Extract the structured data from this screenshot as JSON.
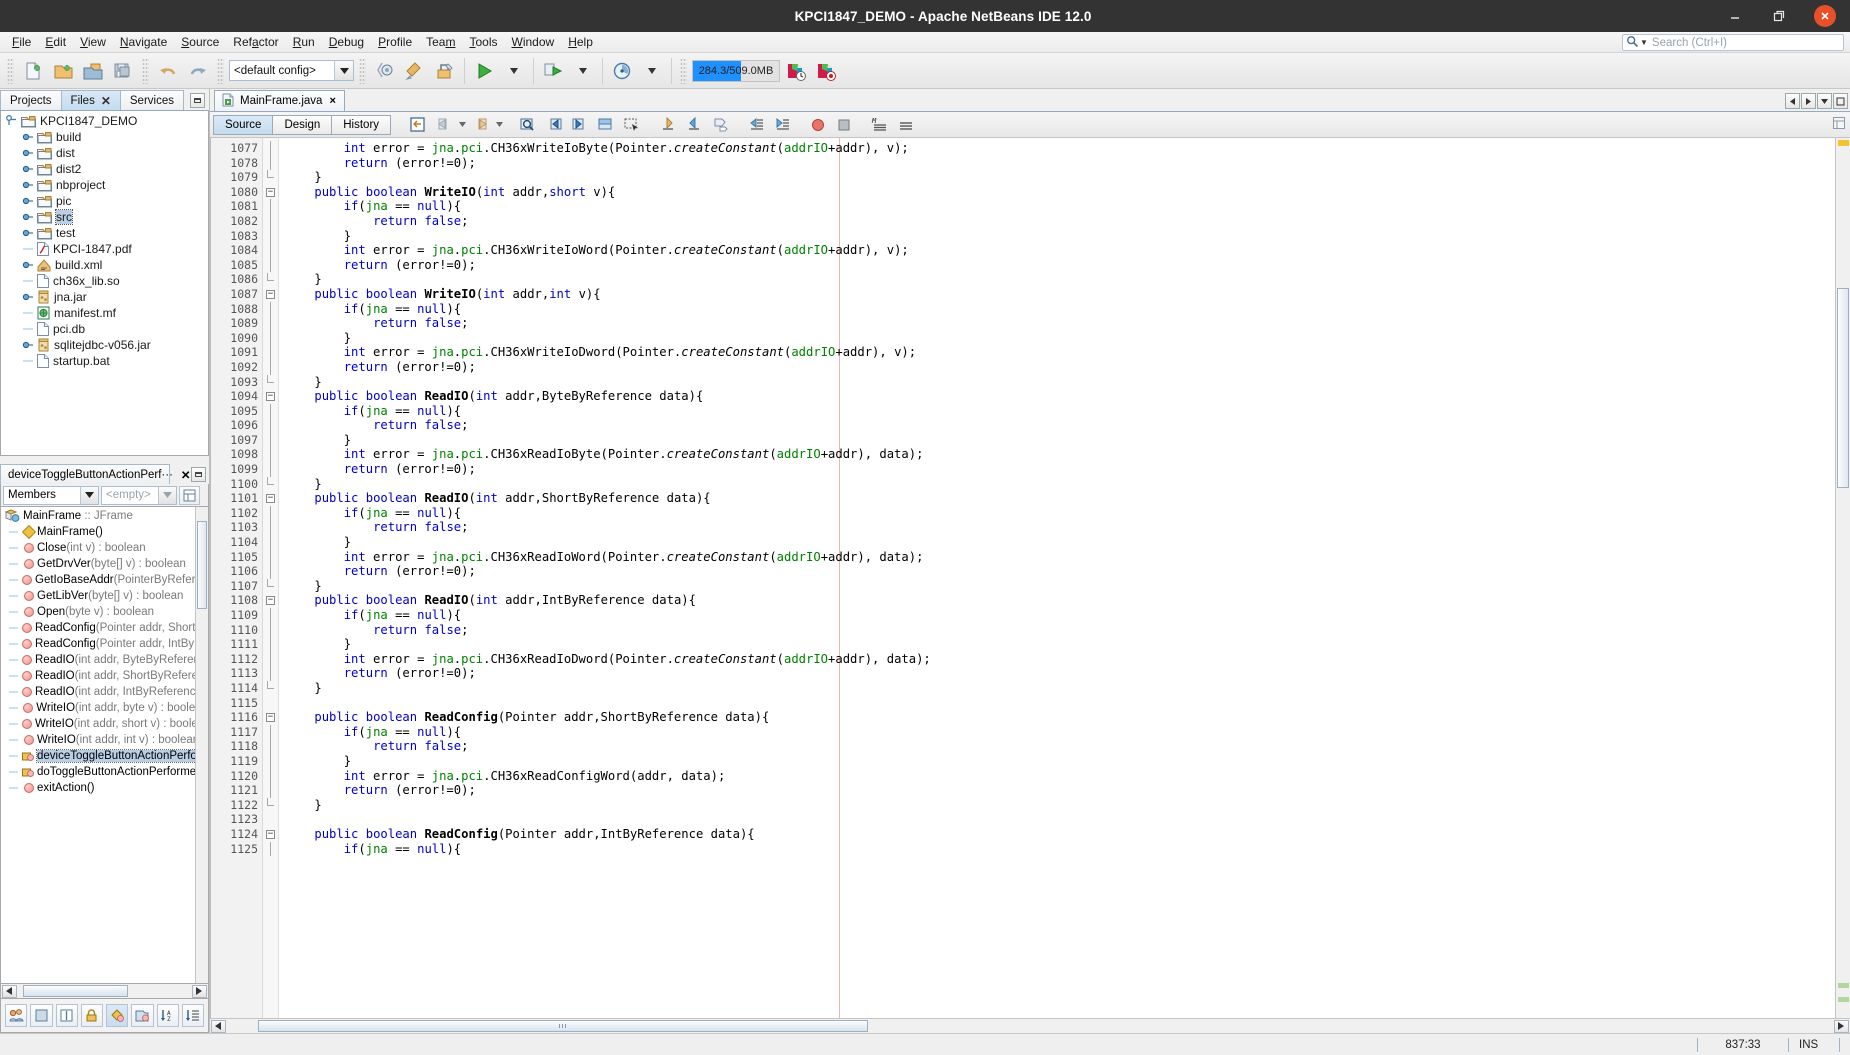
{
  "window": {
    "title": "KPCI1847_DEMO - Apache NetBeans IDE 12.0",
    "minimize_label": "Minimize",
    "restore_label": "Restore",
    "close_label": "Close"
  },
  "menubar": {
    "items": [
      {
        "label": "File",
        "mnemonic": "F"
      },
      {
        "label": "Edit",
        "mnemonic": "E"
      },
      {
        "label": "View",
        "mnemonic": "V"
      },
      {
        "label": "Navigate",
        "mnemonic": "N"
      },
      {
        "label": "Source",
        "mnemonic": "S"
      },
      {
        "label": "Refactor",
        "mnemonic": "a"
      },
      {
        "label": "Run",
        "mnemonic": "R"
      },
      {
        "label": "Debug",
        "mnemonic": "D"
      },
      {
        "label": "Profile",
        "mnemonic": "P"
      },
      {
        "label": "Team",
        "mnemonic": "m"
      },
      {
        "label": "Tools",
        "mnemonic": "T"
      },
      {
        "label": "Window",
        "mnemonic": "W"
      },
      {
        "label": "Help",
        "mnemonic": "H"
      }
    ],
    "search_placeholder": "Search (Ctrl+I)"
  },
  "toolbar": {
    "config_value": "<default config>",
    "memory_label": "284.3/509.0MB",
    "memory_percent": 56,
    "buttons": [
      "new-file",
      "new-project",
      "open-project",
      "save-all",
      "undo",
      "redo",
      "build-project",
      "clean-build-project",
      "run-project",
      "debug-project",
      "profile-project"
    ]
  },
  "left_panel": {
    "tabs": [
      {
        "label": "Projects",
        "active": false,
        "closable": false
      },
      {
        "label": "Files",
        "active": true,
        "closable": true
      },
      {
        "label": "Services",
        "active": false,
        "closable": false
      }
    ],
    "tree": [
      {
        "label": "KPCI1847_DEMO",
        "depth": 0,
        "icon": "folder",
        "expander": "expanded",
        "selected": false
      },
      {
        "label": "build",
        "depth": 1,
        "icon": "folder",
        "expander": "collapsed",
        "selected": false
      },
      {
        "label": "dist",
        "depth": 1,
        "icon": "folder",
        "expander": "collapsed",
        "selected": false
      },
      {
        "label": "dist2",
        "depth": 1,
        "icon": "folder",
        "expander": "collapsed",
        "selected": false
      },
      {
        "label": "nbproject",
        "depth": 1,
        "icon": "folder",
        "expander": "collapsed",
        "selected": false
      },
      {
        "label": "pic",
        "depth": 1,
        "icon": "folder",
        "expander": "collapsed",
        "selected": false
      },
      {
        "label": "src",
        "depth": 1,
        "icon": "folder",
        "expander": "collapsed",
        "selected": true
      },
      {
        "label": "test",
        "depth": 1,
        "icon": "folder",
        "expander": "collapsed",
        "selected": false
      },
      {
        "label": "KPCI-1847.pdf",
        "depth": 1,
        "icon": "pdf",
        "expander": "none",
        "selected": false
      },
      {
        "label": "build.xml",
        "depth": 1,
        "icon": "xml",
        "expander": "collapsed",
        "selected": false
      },
      {
        "label": "ch36x_lib.so",
        "depth": 1,
        "icon": "file",
        "expander": "none",
        "selected": false
      },
      {
        "label": "jna.jar",
        "depth": 1,
        "icon": "jar",
        "expander": "collapsed",
        "selected": false
      },
      {
        "label": "manifest.mf",
        "depth": 1,
        "icon": "manifest",
        "expander": "none",
        "selected": false
      },
      {
        "label": "pci.db",
        "depth": 1,
        "icon": "file",
        "expander": "none",
        "selected": false
      },
      {
        "label": "sqlitejdbc-v056.jar",
        "depth": 1,
        "icon": "jar",
        "expander": "collapsed",
        "selected": false
      },
      {
        "label": "startup.bat",
        "depth": 1,
        "icon": "file",
        "expander": "none",
        "selected": false
      }
    ]
  },
  "navigator": {
    "tab_label": "deviceToggleButtonActionPerf···",
    "filter_value": "Members",
    "filter2_placeholder": "<empty>",
    "root": {
      "name": "MainFrame",
      "sep": " :: ",
      "type": "JFrame"
    },
    "members": [
      {
        "name": "MainFrame()",
        "params": "",
        "ret": "",
        "icon": "constructor",
        "selected": false
      },
      {
        "name": "Close",
        "params": "(int v)",
        "ret": " : boolean",
        "icon": "method",
        "selected": false
      },
      {
        "name": "GetDrvVer",
        "params": "(byte[] v)",
        "ret": " : boolean",
        "icon": "method",
        "selected": false
      },
      {
        "name": "GetIoBaseAddr",
        "params": "(PointerByReferenc…",
        "ret": "",
        "icon": "method",
        "selected": false
      },
      {
        "name": "GetLibVer",
        "params": "(byte[] v)",
        "ret": " : boolean",
        "icon": "method",
        "selected": false
      },
      {
        "name": "Open",
        "params": "(byte v)",
        "ret": " : boolean",
        "icon": "method",
        "selected": false
      },
      {
        "name": "ReadConfig",
        "params": "(Pointer addr, ShortBy…",
        "ret": "",
        "icon": "method",
        "selected": false
      },
      {
        "name": "ReadConfig",
        "params": "(Pointer addr, IntByRef…",
        "ret": "",
        "icon": "method",
        "selected": false
      },
      {
        "name": "ReadIO",
        "params": "(int addr, ByteByReference…",
        "ret": "",
        "icon": "method",
        "selected": false
      },
      {
        "name": "ReadIO",
        "params": "(int addr, ShortByReferenc…",
        "ret": "",
        "icon": "method",
        "selected": false
      },
      {
        "name": "ReadIO",
        "params": "(int addr, IntByReference d…",
        "ret": "",
        "icon": "method",
        "selected": false
      },
      {
        "name": "WriteIO",
        "params": "(int addr, byte v)",
        "ret": " : boolean",
        "icon": "method",
        "selected": false
      },
      {
        "name": "WriteIO",
        "params": "(int addr, short v)",
        "ret": " : boolean",
        "icon": "method",
        "selected": false
      },
      {
        "name": "WriteIO",
        "params": "(int addr, int v)",
        "ret": " : boolean",
        "icon": "method",
        "selected": false
      },
      {
        "name": "deviceToggleButtonActionPerform…",
        "params": "",
        "ret": "",
        "icon": "method-pkg",
        "selected": true
      },
      {
        "name": "doToggleButtonActionPerformed…",
        "params": "",
        "ret": "",
        "icon": "method-pkg",
        "selected": false
      },
      {
        "name": "exitAction()",
        "params": "",
        "ret": "",
        "icon": "method",
        "selected": false
      }
    ],
    "bottom_buttons": [
      "show-inherited-members",
      "show-fields",
      "show-static-members",
      "show-non-public-members",
      "show-constructors",
      "show-inner-classes",
      "sort-alphabetically",
      "sort-by-source"
    ]
  },
  "editor": {
    "tab": {
      "label": "MainFrame.java",
      "close": "×"
    },
    "view_buttons": [
      {
        "label": "Source",
        "active": true
      },
      {
        "label": "Design",
        "active": false
      },
      {
        "label": "History",
        "active": false
      }
    ],
    "toolbar_icons": [
      "last-edit",
      "back",
      "forward",
      "find-selection",
      "previous-bookmark",
      "next-bookmark",
      "toggle-bookmark",
      "toggle-rectangular-selection",
      "shift-line-left",
      "shift-line-right",
      "start-macro-recording",
      "comment",
      "uncomment",
      "toggle-breakpoint",
      "stop-macro-recording",
      "inspect-members",
      "inspect-hierarchy"
    ],
    "first_line": 1077,
    "margin_column": 80,
    "lines": [
      {
        "n": 1077,
        "fold": "line",
        "text": "        int error = jna.pci.CH36xWriteIoByte(Pointer.createConstant(addrIO+addr), v);"
      },
      {
        "n": 1078,
        "fold": "line",
        "text": "        return (error!=0);"
      },
      {
        "n": 1079,
        "fold": "end",
        "text": "    }"
      },
      {
        "n": 1080,
        "fold": "start",
        "text": "    public boolean WriteIO(int addr,short v){"
      },
      {
        "n": 1081,
        "fold": "line",
        "text": "        if(jna == null){"
      },
      {
        "n": 1082,
        "fold": "line",
        "text": "            return false;"
      },
      {
        "n": 1083,
        "fold": "line",
        "text": "        }"
      },
      {
        "n": 1084,
        "fold": "line",
        "text": "        int error = jna.pci.CH36xWriteIoWord(Pointer.createConstant(addrIO+addr), v);"
      },
      {
        "n": 1085,
        "fold": "line",
        "text": "        return (error!=0);"
      },
      {
        "n": 1086,
        "fold": "end",
        "text": "    }"
      },
      {
        "n": 1087,
        "fold": "start",
        "text": "    public boolean WriteIO(int addr,int v){"
      },
      {
        "n": 1088,
        "fold": "line",
        "text": "        if(jna == null){"
      },
      {
        "n": 1089,
        "fold": "line",
        "text": "            return false;"
      },
      {
        "n": 1090,
        "fold": "line",
        "text": "        }"
      },
      {
        "n": 1091,
        "fold": "line",
        "text": "        int error = jna.pci.CH36xWriteIoDword(Pointer.createConstant(addrIO+addr), v);"
      },
      {
        "n": 1092,
        "fold": "line",
        "text": "        return (error!=0);"
      },
      {
        "n": 1093,
        "fold": "end",
        "text": "    }"
      },
      {
        "n": 1094,
        "fold": "start",
        "text": "    public boolean ReadIO(int addr,ByteByReference data){"
      },
      {
        "n": 1095,
        "fold": "line",
        "text": "        if(jna == null){"
      },
      {
        "n": 1096,
        "fold": "line",
        "text": "            return false;"
      },
      {
        "n": 1097,
        "fold": "line",
        "text": "        }"
      },
      {
        "n": 1098,
        "fold": "line",
        "text": "        int error = jna.pci.CH36xReadIoByte(Pointer.createConstant(addrIO+addr), data);"
      },
      {
        "n": 1099,
        "fold": "line",
        "text": "        return (error!=0);"
      },
      {
        "n": 1100,
        "fold": "end",
        "text": "    }"
      },
      {
        "n": 1101,
        "fold": "start",
        "text": "    public boolean ReadIO(int addr,ShortByReference data){"
      },
      {
        "n": 1102,
        "fold": "line",
        "text": "        if(jna == null){"
      },
      {
        "n": 1103,
        "fold": "line",
        "text": "            return false;"
      },
      {
        "n": 1104,
        "fold": "line",
        "text": "        }"
      },
      {
        "n": 1105,
        "fold": "line",
        "text": "        int error = jna.pci.CH36xReadIoWord(Pointer.createConstant(addrIO+addr), data);"
      },
      {
        "n": 1106,
        "fold": "line",
        "text": "        return (error!=0);"
      },
      {
        "n": 1107,
        "fold": "end",
        "text": "    }"
      },
      {
        "n": 1108,
        "fold": "start",
        "text": "    public boolean ReadIO(int addr,IntByReference data){"
      },
      {
        "n": 1109,
        "fold": "line",
        "text": "        if(jna == null){"
      },
      {
        "n": 1110,
        "fold": "line",
        "text": "            return false;"
      },
      {
        "n": 1111,
        "fold": "line",
        "text": "        }"
      },
      {
        "n": 1112,
        "fold": "line",
        "text": "        int error = jna.pci.CH36xReadIoDword(Pointer.createConstant(addrIO+addr), data);"
      },
      {
        "n": 1113,
        "fold": "line",
        "text": "        return (error!=0);"
      },
      {
        "n": 1114,
        "fold": "end",
        "text": "    }"
      },
      {
        "n": 1115,
        "fold": "none",
        "text": ""
      },
      {
        "n": 1116,
        "fold": "start",
        "text": "    public boolean ReadConfig(Pointer addr,ShortByReference data){"
      },
      {
        "n": 1117,
        "fold": "line",
        "text": "        if(jna == null){"
      },
      {
        "n": 1118,
        "fold": "line",
        "text": "            return false;"
      },
      {
        "n": 1119,
        "fold": "line",
        "text": "        }"
      },
      {
        "n": 1120,
        "fold": "line",
        "text": "        int error = jna.pci.CH36xReadConfigWord(addr, data);"
      },
      {
        "n": 1121,
        "fold": "line",
        "text": "        return (error!=0);"
      },
      {
        "n": 1122,
        "fold": "end",
        "text": "    }"
      },
      {
        "n": 1123,
        "fold": "none",
        "text": ""
      },
      {
        "n": 1124,
        "fold": "start",
        "text": "    public boolean ReadConfig(Pointer addr,IntByReference data){"
      },
      {
        "n": 1125,
        "fold": "line",
        "text": "        if(jna == null){"
      }
    ]
  },
  "statusbar": {
    "caret_position": "837:33",
    "insert_mode": "INS"
  },
  "colors": {
    "titlebar_bg": "#333334",
    "close_btn": "#e8502a",
    "keyword": "#0000cc",
    "field": "#008000",
    "memory_bar": "#1e90ff",
    "selection": "#b8cfe5",
    "margin_line": "#f2b4b4"
  }
}
